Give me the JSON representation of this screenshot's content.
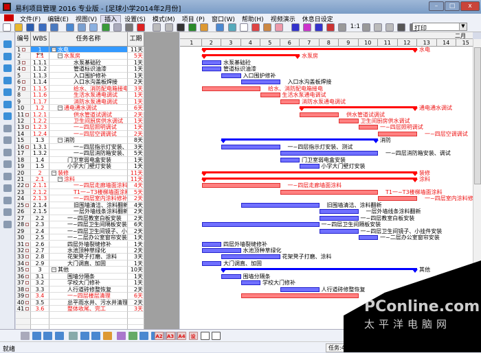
{
  "window": {
    "title": "易利项目管理 2016 专业版 - [足球小学2014年2月份]",
    "min": "–",
    "max": "□",
    "close": "x"
  },
  "menu": [
    "文件(F)",
    "编辑(E)",
    "视图(V)",
    "插入",
    "设置(S)",
    "模式(M)",
    "项目 (P)",
    "窗口(W)",
    "帮助(H)",
    "视频演示",
    "休息日设定"
  ],
  "toolbar": {
    "print_select": "打印",
    "zoom_1to1": "1:1"
  },
  "table": {
    "headers": [
      "编号",
      "WBS码",
      "任务名称",
      "工期"
    ],
    "rows": [
      {
        "n": "1",
        "wbs": "1",
        "name": "水电",
        "dur": "11天",
        "lvl": 0,
        "red": false,
        "sum": true,
        "mk": true,
        "sel": true,
        "start": 2,
        "color": "red"
      },
      {
        "n": "2",
        "wbs": "1.1",
        "name": "水泵房",
        "dur": "5天",
        "lvl": 1,
        "red": true,
        "sum": true,
        "mk": false,
        "start": 2,
        "color": "red"
      },
      {
        "n": "3",
        "wbs": "1.1.1",
        "name": "水泵基础砼",
        "dur": "1天",
        "lvl": 2,
        "red": false,
        "mk": true,
        "start": 2,
        "color": "blue"
      },
      {
        "n": "4",
        "wbs": "1.1.2",
        "name": "管道标识油漆",
        "dur": "1天",
        "lvl": 2,
        "red": false,
        "mk": true,
        "start": 2,
        "color": "blue"
      },
      {
        "n": "5",
        "wbs": "1.1.3",
        "name": "入口围护修补",
        "dur": "1天",
        "lvl": 2,
        "red": false,
        "mk": false,
        "start": 3,
        "color": "blue"
      },
      {
        "n": "6",
        "wbs": "1.1.4",
        "name": "入口水沟盖板焊接",
        "dur": "2天",
        "lvl": 2,
        "red": false,
        "mk": true,
        "start": 4,
        "color": "blue"
      },
      {
        "n": "7",
        "wbs": "1.1.5",
        "name": "给水、消防配电箱接电",
        "dur": "3天",
        "lvl": 2,
        "red": true,
        "mk": true,
        "start": 2,
        "color": "red"
      },
      {
        "n": "8",
        "wbs": "1.1.6",
        "name": "生活水泵通电调试",
        "dur": "1天",
        "lvl": 2,
        "red": true,
        "mk": false,
        "start": 5,
        "color": "red"
      },
      {
        "n": "9",
        "wbs": "1.1.7",
        "name": "消防水泵通电调试",
        "dur": "1天",
        "lvl": 2,
        "red": true,
        "mk": false,
        "start": 6,
        "color": "red"
      },
      {
        "n": "10",
        "wbs": "1.2",
        "name": "通电通水调试",
        "dur": "6天",
        "lvl": 1,
        "red": true,
        "sum": true,
        "mk": false,
        "start": 7,
        "color": "red"
      },
      {
        "n": "11",
        "wbs": "1.2.1",
        "name": "供水管道试调试",
        "dur": "2天",
        "lvl": 2,
        "red": true,
        "mk": true,
        "start": 7,
        "color": "red"
      },
      {
        "n": "12",
        "wbs": "1.2.2",
        "name": "卫生间厨房供水调试",
        "dur": "1天",
        "lvl": 2,
        "red": true,
        "mk": false,
        "start": 9,
        "color": "red"
      },
      {
        "n": "13",
        "wbs": "1.2.3",
        "name": "一~四层照明调试",
        "dur": "1天",
        "lvl": 2,
        "red": true,
        "mk": true,
        "start": 10,
        "color": "red"
      },
      {
        "n": "14",
        "wbs": "1.2.4",
        "name": "一~四层空调调试",
        "dur": "2天",
        "lvl": 2,
        "red": true,
        "mk": false,
        "start": 11,
        "color": "red"
      },
      {
        "n": "15",
        "wbs": "1.3",
        "name": "消防",
        "dur": "8天",
        "lvl": 1,
        "red": false,
        "sum": true,
        "mk": false,
        "start": 3,
        "color": "blue"
      },
      {
        "n": "16",
        "wbs": "1.3.1",
        "name": "一~四层指示灯安装、测试",
        "dur": "3天",
        "lvl": 2,
        "red": false,
        "mk": true,
        "start": 3,
        "color": "blue"
      },
      {
        "n": "17",
        "wbs": "1.3.2",
        "name": "一~四层消防箱安装、调试",
        "dur": "5天",
        "lvl": 2,
        "red": false,
        "mk": false,
        "start": 6,
        "color": "blue"
      },
      {
        "n": "18",
        "wbs": "1.4",
        "name": "门卫室弱电盒安装",
        "dur": "1天",
        "lvl": 1,
        "red": false,
        "mk": false,
        "start": 6,
        "color": "blue"
      },
      {
        "n": "19",
        "wbs": "1.5",
        "name": "小学大门壁灯安装",
        "dur": "1天",
        "lvl": 1,
        "red": false,
        "mk": false,
        "start": 7,
        "color": "blue"
      },
      {
        "n": "20",
        "wbs": "2",
        "name": "装修",
        "dur": "11天",
        "lvl": 0,
        "red": true,
        "sum": true,
        "mk": false,
        "start": 2,
        "color": "red"
      },
      {
        "n": "21",
        "wbs": "2.1",
        "name": "涂料",
        "dur": "11天",
        "lvl": 1,
        "red": true,
        "sum": true,
        "mk": false,
        "start": 2,
        "color": "red"
      },
      {
        "n": "22",
        "wbs": "2.1.1",
        "name": "一~四层走廊墙面涂料",
        "dur": "4天",
        "lvl": 2,
        "red": true,
        "mk": true,
        "start": 2,
        "color": "red"
      },
      {
        "n": "23",
        "wbs": "2.1.2",
        "name": "T1一~T3楼梯墙面涂料",
        "dur": "5天",
        "lvl": 2,
        "red": true,
        "mk": false,
        "start": 6,
        "color": "red"
      },
      {
        "n": "24",
        "wbs": "2.1.3",
        "name": "一~四层室内涂料修补",
        "dur": "2天",
        "lvl": 2,
        "red": true,
        "mk": false,
        "start": 11,
        "color": "red"
      },
      {
        "n": "25",
        "wbs": "2.1.4",
        "name": "旧围墙清洁、涂料翻新",
        "dur": "4天",
        "lvl": 2,
        "red": false,
        "mk": true,
        "start": 4,
        "color": "blue"
      },
      {
        "n": "26",
        "wbs": "2.1.5",
        "name": "一层外墙线条涂料翻新",
        "dur": "2天",
        "lvl": 2,
        "red": false,
        "mk": false,
        "start": 8,
        "color": "blue"
      },
      {
        "n": "27",
        "wbs": "2.2",
        "name": "一~四层教室白板安装",
        "dur": "2天",
        "lvl": 1,
        "red": false,
        "mk": false,
        "start": 8,
        "color": "blue"
      },
      {
        "n": "28",
        "wbs": "2.3",
        "name": "一~四层卫生间隔板安装",
        "dur": "6天",
        "lvl": 1,
        "red": false,
        "mk": true,
        "start": 2,
        "color": "blue"
      },
      {
        "n": "29",
        "wbs": "2.4",
        "name": "一~四层卫生间镜子、小...",
        "glabel": "一~四层卫生间镜子、小挂件安装",
        "dur": "2天",
        "lvl": 1,
        "red": false,
        "mk": false,
        "start": 8,
        "color": "blue"
      },
      {
        "n": "30",
        "wbs": "2.5",
        "name": "一~二层办公室窗帘安装",
        "dur": "1天",
        "lvl": 1,
        "red": false,
        "mk": false,
        "start": 10,
        "color": "blue"
      },
      {
        "n": "31",
        "wbs": "2.6",
        "name": "四层外墙裂缝修补",
        "dur": "1天",
        "lvl": 1,
        "red": false,
        "mk": true,
        "start": 2,
        "color": "blue"
      },
      {
        "n": "32",
        "wbs": "2.7",
        "name": "水池顶种草绿化",
        "dur": "2天",
        "lvl": 1,
        "red": false,
        "mk": true,
        "start": 2,
        "color": "blue"
      },
      {
        "n": "33",
        "wbs": "2.8",
        "name": "花架凳子打磨、涂料",
        "dur": "3天",
        "lvl": 1,
        "red": false,
        "mk": true,
        "start": 3,
        "color": "blue"
      },
      {
        "n": "34",
        "wbs": "2.9",
        "name": "大门调直、加固",
        "dur": "1天",
        "lvl": 1,
        "red": false,
        "mk": true,
        "start": 2,
        "color": "blue"
      },
      {
        "n": "35",
        "wbs": "3",
        "name": "其他",
        "dur": "10天",
        "lvl": 0,
        "red": false,
        "sum": true,
        "mk": true,
        "start": 3,
        "color": "blue"
      },
      {
        "n": "36",
        "wbs": "3.1",
        "name": "围墙分隔条",
        "dur": "1天",
        "lvl": 1,
        "red": false,
        "mk": true,
        "start": 3,
        "color": "blue"
      },
      {
        "n": "37",
        "wbs": "3.2",
        "name": "学校大门修补",
        "dur": "1天",
        "lvl": 1,
        "red": false,
        "mk": true,
        "start": 4,
        "color": "blue"
      },
      {
        "n": "38",
        "wbs": "3.3",
        "name": "人行道砖修整恢复",
        "dur": "2天",
        "lvl": 1,
        "red": false,
        "mk": true,
        "start": 6,
        "color": "blue"
      },
      {
        "n": "39",
        "wbs": "3.4",
        "name": "一~四层楼层清理",
        "dur": "6天",
        "lvl": 1,
        "red": true,
        "mk": true,
        "start": 4,
        "color": "red",
        "nolabel": true
      },
      {
        "n": "40",
        "wbs": "3.5",
        "name": "总平雨水井、污水井清理",
        "dur": "2天",
        "lvl": 1,
        "red": false,
        "mk": true,
        "start": 12,
        "color": "blue",
        "nolabel": true
      },
      {
        "n": "41",
        "wbs": "3.6",
        "name": "整体收尾、完工",
        "dur": "3天",
        "lvl": 1,
        "red": true,
        "mk": true,
        "start": 12,
        "color": "red",
        "nolabel": true
      }
    ]
  },
  "gantt": {
    "month": "二月",
    "days": [
      "1",
      "2",
      "3",
      "4",
      "5",
      "6",
      "7",
      "8",
      "9",
      "10",
      "11",
      "12",
      "13",
      "14",
      "15"
    ]
  },
  "status": {
    "left": "就绪",
    "count": "任务:41个"
  },
  "bottom_buttons": [
    "A2",
    "A3",
    "A4",
    "设"
  ],
  "watermark": {
    "logo": "PConline.com.cn",
    "cn": "太平洋电脑网"
  }
}
